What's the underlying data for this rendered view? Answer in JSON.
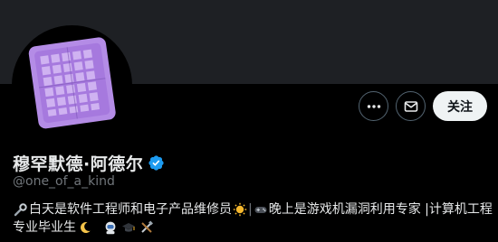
{
  "profile": {
    "display_name": "穆罕默德·阿德尔",
    "handle": "@one_of_a_kind",
    "verified": true,
    "verified_color": "#1d9bf0"
  },
  "actions": {
    "more_icon": "more-horizontal-icon",
    "message_icon": "mail-icon",
    "follow_label": "关注"
  },
  "bio": {
    "line1_part1": "白天是软件工程师和电子产品维修员",
    "line1_part2": "晚上是游戏机漏洞利用专家 |计算机工程",
    "line2": "专业毕业生",
    "icons": [
      "wrench-icon",
      "sun-icon",
      "game-controller-icon",
      "moon-icon",
      "astronaut-icon",
      "graduation-cap-icon",
      "tools-icon"
    ]
  },
  "colors": {
    "background": "#000000",
    "banner": "#1e2024",
    "text_primary": "#e7e9ea",
    "text_secondary": "#71767b",
    "follow_button": "#eff3f4",
    "avatar_chip": "#b48ce6"
  }
}
